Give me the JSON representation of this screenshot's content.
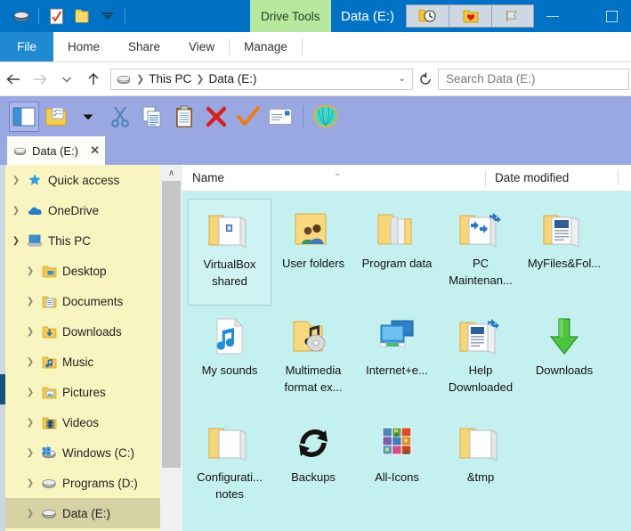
{
  "titlebar": {
    "quick_access": [
      {
        "name": "drive-icon",
        "label": "Drive"
      },
      {
        "name": "checklist-document-icon",
        "label": "Properties"
      },
      {
        "name": "folder-icon",
        "label": "New folder"
      },
      {
        "name": "chevron-down-icon",
        "label": "Customize Quick Access Toolbar"
      }
    ],
    "contextual_tab": "Drive Tools",
    "window_title": "Data (E:)",
    "toolbar_buttons": [
      {
        "name": "history-clock-icon",
        "label": "History"
      },
      {
        "name": "favorites-folder-icon",
        "label": "Favorites"
      },
      {
        "name": "bookmark-flag-icon",
        "label": "Bookmark"
      }
    ],
    "minimize_label": "Minimize",
    "maximize_label": "Maximize",
    "colors": {
      "title_bg": "#0072c6",
      "context_tab_bg": "#b6e8a0"
    }
  },
  "ribbon": {
    "file_tab": "File",
    "tabs": [
      "Home",
      "Share",
      "View"
    ],
    "contextual_tab": "Manage"
  },
  "address": {
    "back_label": "Back",
    "forward_label": "Forward",
    "recent_label": "Recent locations",
    "up_label": "Up one level",
    "drive_icon": "drive-icon",
    "crumbs": [
      "This PC",
      "Data (E:)"
    ],
    "dropdown_label": "Previous locations",
    "refresh_label": "Refresh",
    "search_placeholder": "Search Data (E:)"
  },
  "toolbar": {
    "buttons": [
      {
        "name": "navigation-pane-button",
        "label": "Navigation pane",
        "selected": true
      },
      {
        "name": "folder-options-button",
        "label": "Folder options",
        "selected": false
      },
      {
        "name": "dropdown-arrow-button",
        "label": "More options",
        "selected": false
      },
      {
        "name": "cut-button",
        "label": "Cut",
        "selected": false
      },
      {
        "name": "copy-button",
        "label": "Copy",
        "selected": false
      },
      {
        "name": "paste-button",
        "label": "Paste",
        "selected": false
      },
      {
        "name": "delete-button",
        "label": "Delete",
        "selected": false
      },
      {
        "name": "confirm-button",
        "label": "Confirm",
        "selected": false
      },
      {
        "name": "rename-button",
        "label": "Rename",
        "selected": false
      },
      {
        "name": "shell-button",
        "label": "Shell",
        "selected": false
      }
    ]
  },
  "tabs": {
    "items": [
      {
        "label": "Data (E:)",
        "close": "✕",
        "active": true
      }
    ]
  },
  "sidebar": {
    "items": [
      {
        "label": "Quick access",
        "icon": "star-icon",
        "level": 0,
        "expanded": false,
        "selected": false
      },
      {
        "label": "OneDrive",
        "icon": "cloud-icon",
        "level": 0,
        "expanded": false,
        "selected": false
      },
      {
        "label": "This PC",
        "icon": "computer-icon",
        "level": 0,
        "expanded": true,
        "selected": false
      },
      {
        "label": "Desktop",
        "icon": "desktop-folder-icon",
        "level": 1,
        "expanded": false,
        "selected": false
      },
      {
        "label": "Documents",
        "icon": "documents-folder-icon",
        "level": 1,
        "expanded": false,
        "selected": false
      },
      {
        "label": "Downloads",
        "icon": "downloads-folder-icon",
        "level": 1,
        "expanded": false,
        "selected": false
      },
      {
        "label": "Music",
        "icon": "music-folder-icon",
        "level": 1,
        "expanded": false,
        "selected": false
      },
      {
        "label": "Pictures",
        "icon": "pictures-folder-icon",
        "level": 1,
        "expanded": false,
        "selected": false
      },
      {
        "label": "Videos",
        "icon": "videos-folder-icon",
        "level": 1,
        "expanded": false,
        "selected": false
      },
      {
        "label": "Windows (C:)",
        "icon": "windows-drive-icon",
        "level": 1,
        "expanded": false,
        "selected": false
      },
      {
        "label": "Programs (D:)",
        "icon": "drive-icon",
        "level": 1,
        "expanded": false,
        "selected": false
      },
      {
        "label": "Data (E:)",
        "icon": "drive-icon",
        "level": 1,
        "expanded": false,
        "selected": true
      }
    ],
    "bg_color": "#f9f5c0",
    "selected_color": "#d6d2a5"
  },
  "filepane": {
    "columns": {
      "name": "Name",
      "date_modified": "Date modified"
    },
    "bg_color": "#c5f0f0",
    "items": [
      {
        "label": "VirtualBox shared",
        "icon": "folder-open-icon",
        "selected": true
      },
      {
        "label": "User folders",
        "icon": "users-folder-icon",
        "selected": false
      },
      {
        "label": "Program data",
        "icon": "folder-files-icon",
        "selected": false
      },
      {
        "label": "PC Maintenan...",
        "icon": "folder-shortcut-icon",
        "selected": false
      },
      {
        "label": "MyFiles&Fol...",
        "icon": "folder-document-icon",
        "selected": false
      },
      {
        "label": "My sounds",
        "icon": "music-file-icon",
        "selected": false
      },
      {
        "label": "Multimedia format ex...",
        "icon": "folder-cd-icon",
        "selected": false
      },
      {
        "label": "Internet+e...",
        "icon": "monitors-icon",
        "selected": false
      },
      {
        "label": "Help Downloaded",
        "icon": "folder-shortcut-doc-icon",
        "selected": false
      },
      {
        "label": "Downloads",
        "icon": "green-down-arrow-icon",
        "selected": false
      },
      {
        "label": "Configurati... notes",
        "icon": "folder-open-icon",
        "selected": false
      },
      {
        "label": "Backups",
        "icon": "refresh-circle-icon",
        "selected": false
      },
      {
        "label": "All-Icons",
        "icon": "image-grid-icon",
        "selected": false
      },
      {
        "label": "&tmp",
        "icon": "folder-open-icon",
        "selected": false
      }
    ]
  },
  "scrollbars": {
    "vertical_up_arrow": "∧",
    "sidebar_scroll_label": "Sidebar scrollbar"
  }
}
